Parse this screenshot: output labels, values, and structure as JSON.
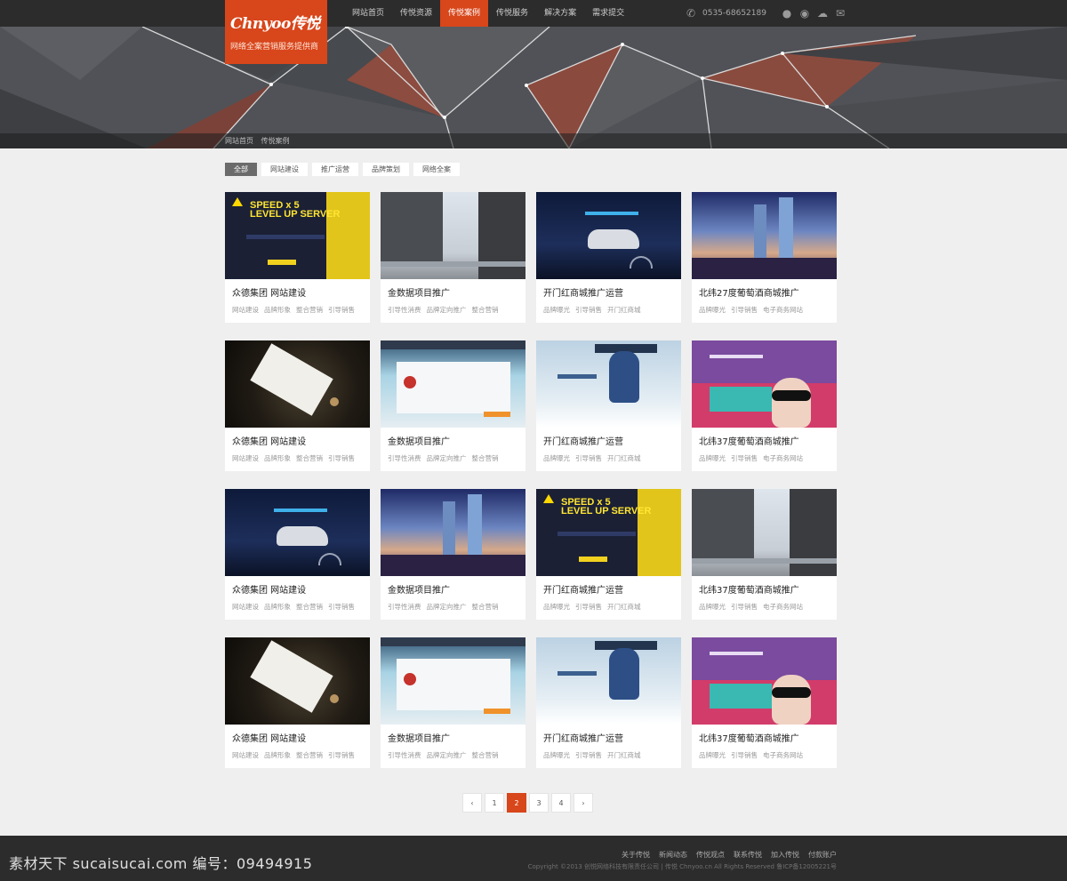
{
  "brand": {
    "logo_text": "Chnyoo传悦",
    "slogan": "网络全案营销服务提供商"
  },
  "nav": [
    "网站首页",
    "传悦资源",
    "传悦案例",
    "传悦服务",
    "解决方案",
    "需求提交"
  ],
  "nav_active": 2,
  "contact": {
    "phone": "0535-68652189"
  },
  "breadcrumb": [
    "网站首页",
    "传悦案例"
  ],
  "filters": [
    "全部",
    "网站建设",
    "推广运营",
    "品牌策划",
    "网络全案"
  ],
  "filter_active": 0,
  "cases": [
    {
      "title": "众德集团 网站建设",
      "tags": [
        "网站建设",
        "品牌形象",
        "整合营销",
        "引导销售"
      ],
      "thumb": "speed"
    },
    {
      "title": "金数据项目推广",
      "tags": [
        "引导性消费",
        "品牌定向推广",
        "整合营销"
      ],
      "thumb": "bldg"
    },
    {
      "title": "开门红商城推广运营",
      "tags": [
        "品牌曝光",
        "引导销售",
        "开门红商城"
      ],
      "thumb": "car"
    },
    {
      "title": "北纬27度葡萄酒商城推广",
      "tags": [
        "品牌曝光",
        "引导销售",
        "电子商务网站"
      ],
      "thumb": "tower"
    },
    {
      "title": "众德集团 网站建设",
      "tags": [
        "网站建设",
        "品牌形象",
        "整合营销",
        "引导销售"
      ],
      "thumb": "letter"
    },
    {
      "title": "金数据项目推广",
      "tags": [
        "引导性消费",
        "品牌定向推广",
        "整合营销"
      ],
      "thumb": "emo"
    },
    {
      "title": "开门红商城推广运营",
      "tags": [
        "品牌曝光",
        "引导销售",
        "开门红商城"
      ],
      "thumb": "snow"
    },
    {
      "title": "北纬37度葡萄酒商城推广",
      "tags": [
        "品牌曝光",
        "引导销售",
        "电子商务网站"
      ],
      "thumb": "purple"
    },
    {
      "title": "众德集团 网站建设",
      "tags": [
        "网站建设",
        "品牌形象",
        "整合营销",
        "引导销售"
      ],
      "thumb": "car"
    },
    {
      "title": "金数据项目推广",
      "tags": [
        "引导性消费",
        "品牌定向推广",
        "整合营销"
      ],
      "thumb": "tower"
    },
    {
      "title": "开门红商城推广运营",
      "tags": [
        "品牌曝光",
        "引导销售",
        "开门红商城"
      ],
      "thumb": "speed"
    },
    {
      "title": "北纬37度葡萄酒商城推广",
      "tags": [
        "品牌曝光",
        "引导销售",
        "电子商务网站"
      ],
      "thumb": "bldg"
    },
    {
      "title": "众德集团 网站建设",
      "tags": [
        "网站建设",
        "品牌形象",
        "整合营销",
        "引导销售"
      ],
      "thumb": "letter"
    },
    {
      "title": "金数据项目推广",
      "tags": [
        "引导性消费",
        "品牌定向推广",
        "整合营销"
      ],
      "thumb": "emo"
    },
    {
      "title": "开门红商城推广运营",
      "tags": [
        "品牌曝光",
        "引导销售",
        "开门红商城"
      ],
      "thumb": "snow"
    },
    {
      "title": "北纬37度葡萄酒商城推广",
      "tags": [
        "品牌曝光",
        "引导销售",
        "电子商务网站"
      ],
      "thumb": "purple"
    }
  ],
  "pager": {
    "prev": "‹",
    "pages": [
      "1",
      "2",
      "3",
      "4"
    ],
    "active": 1,
    "next": "›"
  },
  "footer": {
    "links": [
      "关于传悦",
      "新闻动态",
      "传悦观点",
      "联系传悦",
      "加入传悦",
      "付款账户"
    ],
    "copyright": "Copyright ©2013  创悦网络科技有限责任公司  |  传悦 Chnyoo.cn All Rights Reserved  鲁ICP备12005221号"
  },
  "watermark": "素材天下 sucaisucai.com  编号：09494915",
  "colors": {
    "accent": "#d8461b",
    "topbar": "#2c2c2c",
    "page_bg": "#efefef"
  },
  "icons": [
    "phone-icon",
    "qq-icon",
    "weibo-icon",
    "wechat-icon",
    "mail-icon"
  ]
}
